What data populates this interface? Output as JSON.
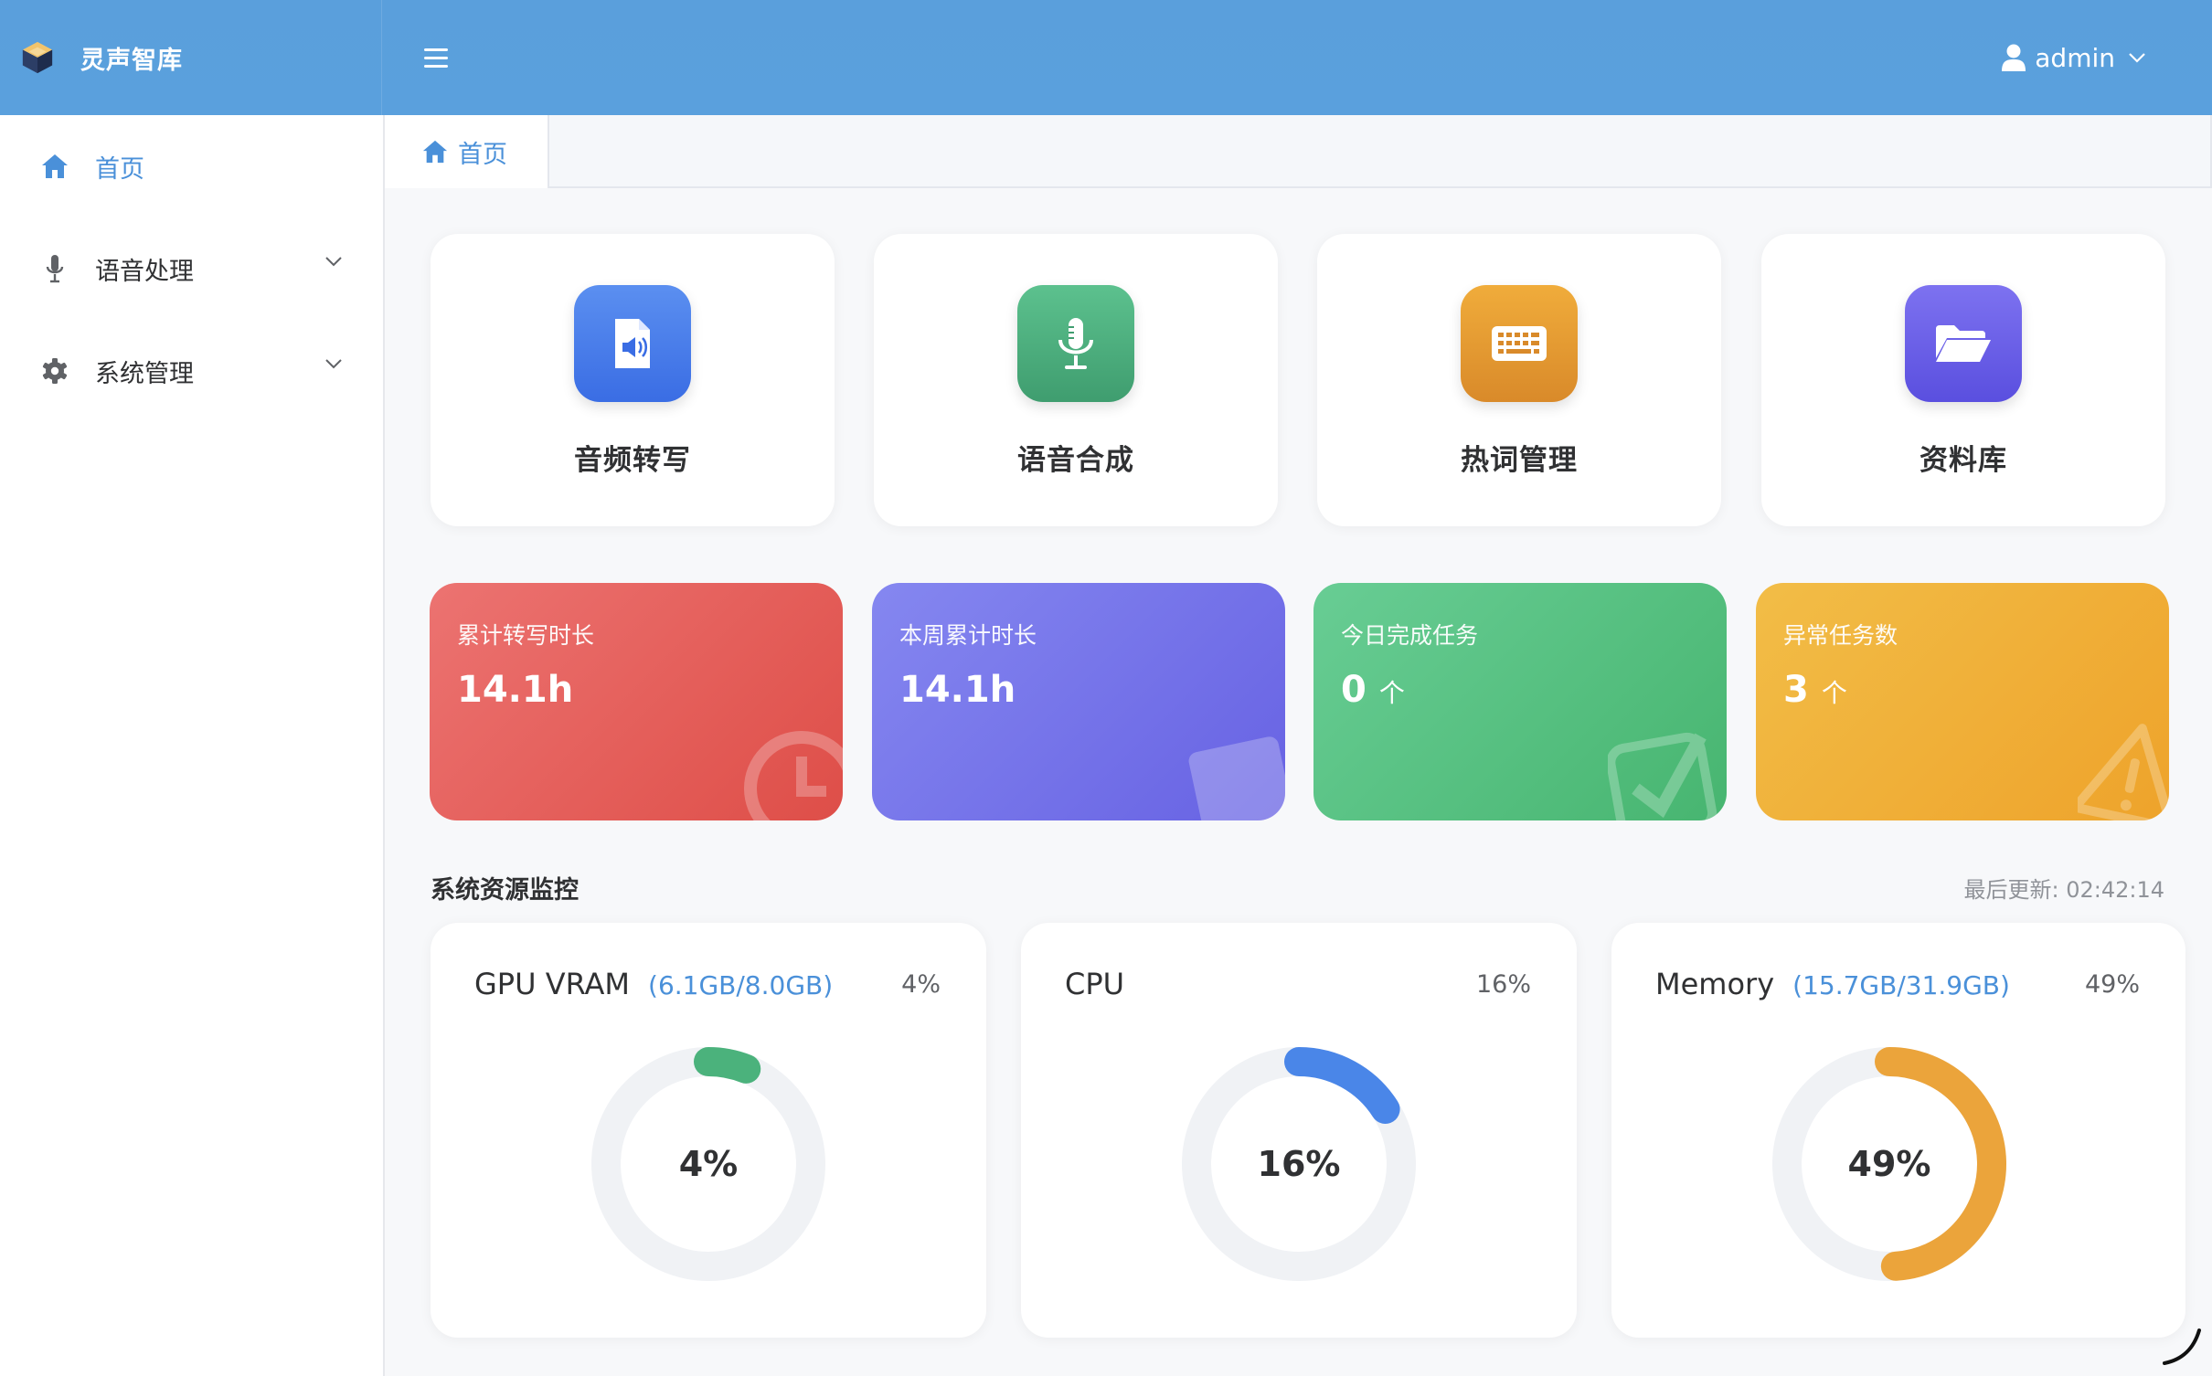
{
  "app": {
    "name": "灵声智库"
  },
  "user": {
    "name": "admin"
  },
  "sidebar": {
    "items": [
      {
        "label": "首页",
        "icon": "home-icon",
        "active": true
      },
      {
        "label": "语音处理",
        "icon": "microphone-icon",
        "expandable": true
      },
      {
        "label": "系统管理",
        "icon": "gear-icon",
        "expandable": true
      }
    ]
  },
  "tabs": [
    {
      "label": "首页",
      "icon": "home-icon"
    }
  ],
  "quick_actions": [
    {
      "label": "音频转写",
      "icon": "audio-file-icon",
      "color": "#3d74e8"
    },
    {
      "label": "语音合成",
      "icon": "microphone-icon",
      "color": "#4aa97a"
    },
    {
      "label": "热词管理",
      "icon": "keyboard-icon",
      "color": "#e0962f"
    },
    {
      "label": "资料库",
      "icon": "folder-open-icon",
      "color": "#5c54e2"
    }
  ],
  "stats": [
    {
      "title": "累计转写时长",
      "value": "14.1h",
      "unit": "",
      "icon": "clock-icon",
      "color": "#e2534f"
    },
    {
      "title": "本周累计时长",
      "value": "14.1h",
      "unit": "",
      "icon": "calendar-icon",
      "color": "#6e6ae8"
    },
    {
      "title": "今日完成任务",
      "value": "0",
      "unit": "个",
      "icon": "check-icon",
      "color": "#4cbd7e"
    },
    {
      "title": "异常任务数",
      "value": "3",
      "unit": "个",
      "icon": "warning-icon",
      "color": "#eeaa34"
    }
  ],
  "monitor": {
    "title": "系统资源监控",
    "last_update": "最后更新: 02:42:14",
    "resources": [
      {
        "name": "GPU VRAM",
        "detail": "(6.1GB/8.0GB)",
        "percent_label": "4%",
        "percent": 4,
        "color": "#4bb27c"
      },
      {
        "name": "CPU",
        "detail": "",
        "percent_label": "16%",
        "percent": 16,
        "color": "#4a86e8"
      },
      {
        "name": "Memory",
        "detail": "(15.7GB/31.9GB)",
        "percent_label": "49%",
        "percent": 49,
        "color": "#eba43b"
      }
    ]
  }
}
